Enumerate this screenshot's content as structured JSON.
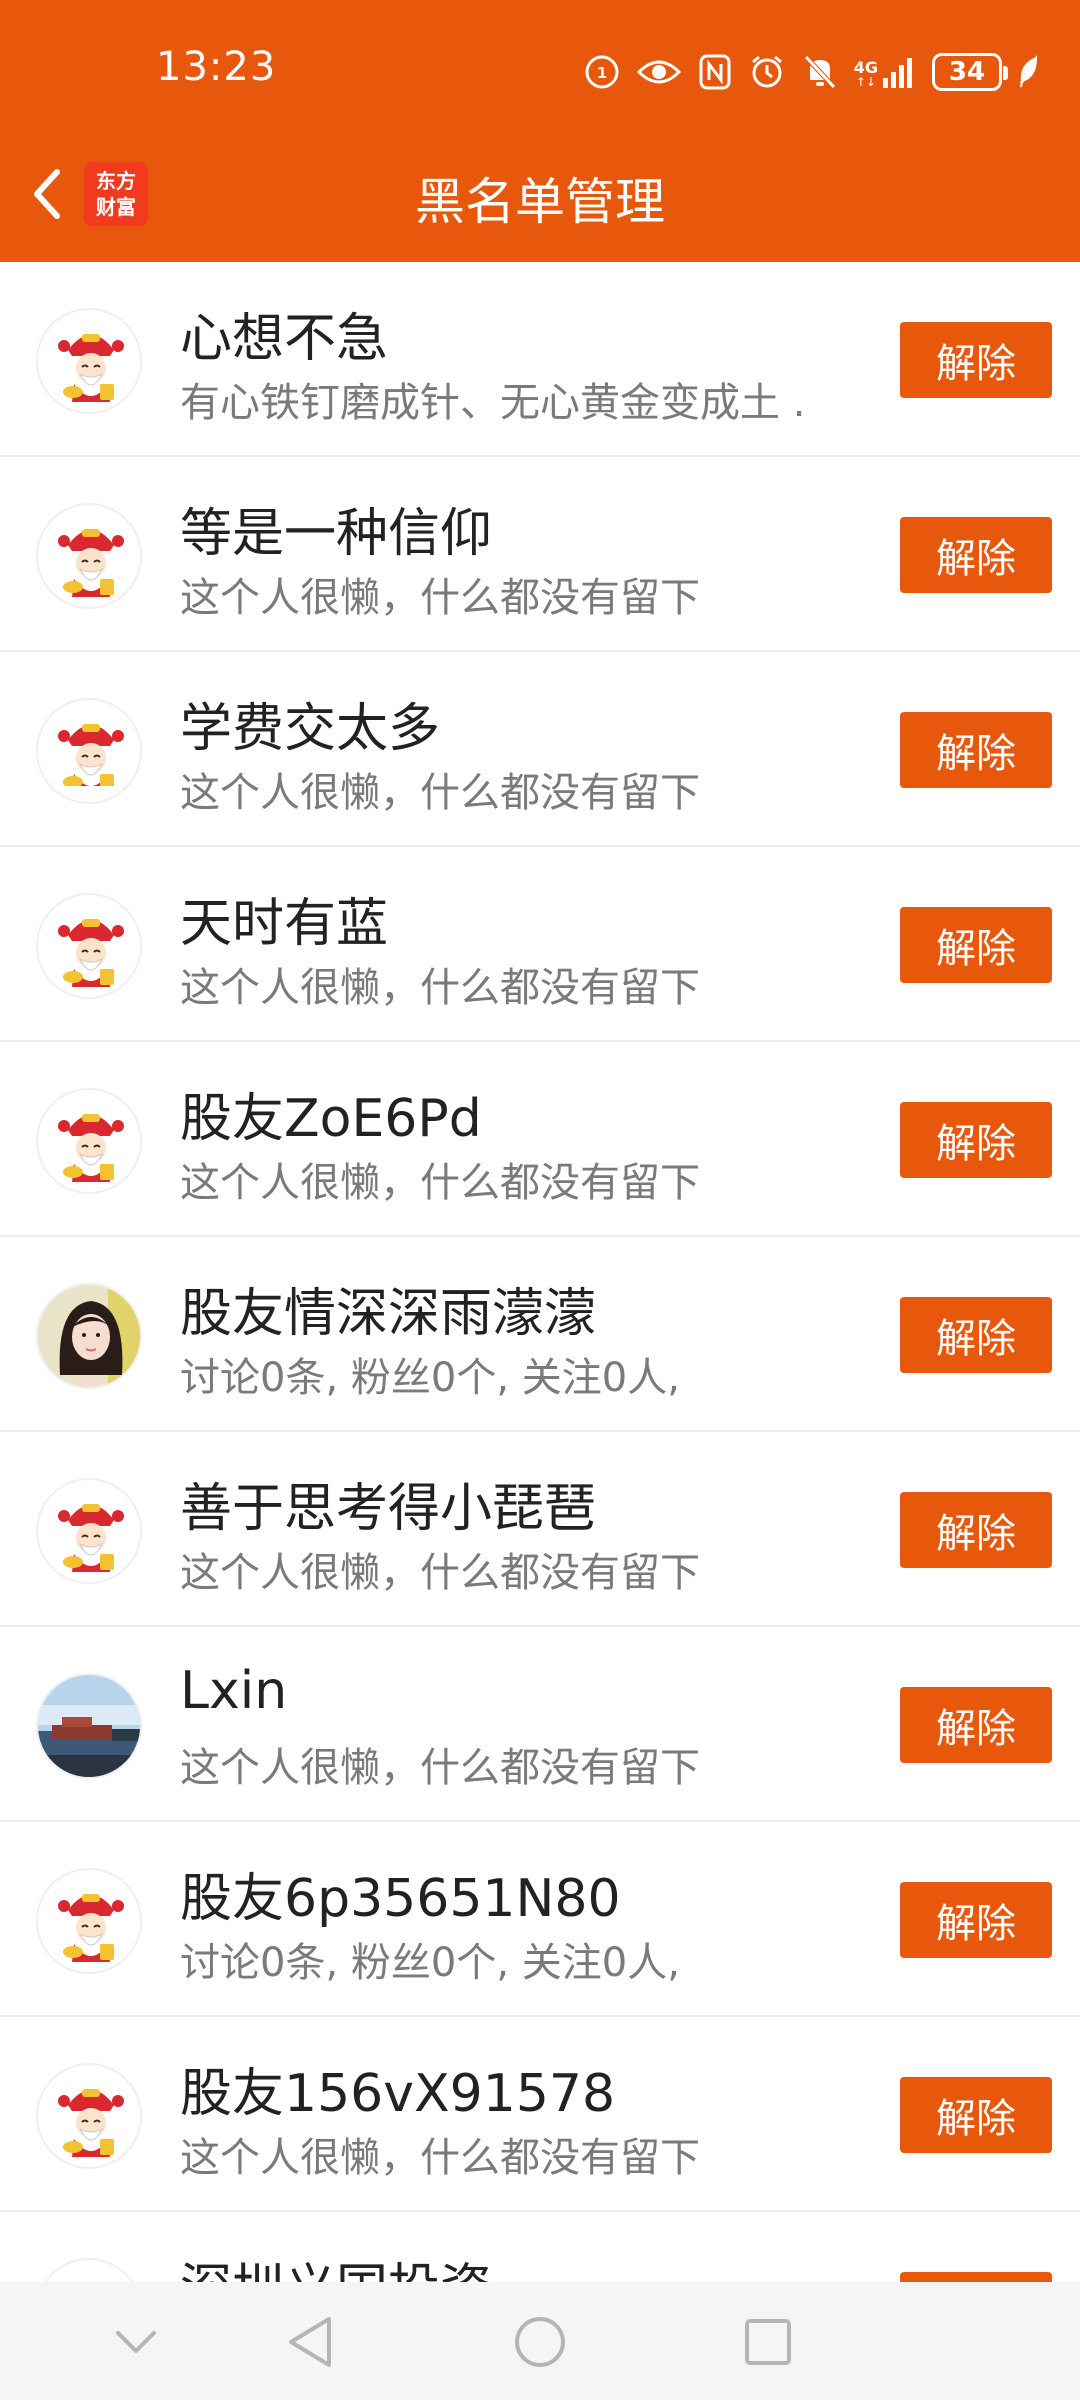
{
  "status_bar": {
    "time": "13:23",
    "network": "4G",
    "battery": "34",
    "icons": [
      "hd-icon",
      "eye-icon",
      "nfc-icon",
      "alarm-icon",
      "mute-icon",
      "signal-icon",
      "battery-icon",
      "leaf-icon"
    ]
  },
  "header": {
    "title": "黑名单管理",
    "logo_line1": "东方",
    "logo_line2": "财富",
    "back_icon": "chevron-left-icon"
  },
  "remove_label": "解除",
  "items": [
    {
      "name": "心想不急",
      "desc": "有心铁钉磨成针、无心黄金变成土 .",
      "avatar": "caishen"
    },
    {
      "name": "等是一种信仰",
      "desc": "这个人很懒，什么都没有留下",
      "avatar": "caishen"
    },
    {
      "name": "学费交太多",
      "desc": "这个人很懒，什么都没有留下",
      "avatar": "caishen-review"
    },
    {
      "name": "天时有蓝",
      "desc": "这个人很懒，什么都没有留下",
      "avatar": "caishen"
    },
    {
      "name": "股友ZoE6Pd",
      "desc": "这个人很懒，什么都没有留下",
      "avatar": "caishen"
    },
    {
      "name": "股友情深深雨濛濛",
      "desc": "讨论0条, 粉丝0个, 关注0人,",
      "avatar": "photo-woman"
    },
    {
      "name": "善于思考得小琵琶",
      "desc": "这个人很懒，什么都没有留下",
      "avatar": "caishen"
    },
    {
      "name": "Lxin",
      "desc": "这个人很懒，什么都没有留下",
      "avatar": "photo-harbor"
    },
    {
      "name": "股友6p35651N80",
      "desc": "讨论0条, 粉丝0个, 关注0人,",
      "avatar": "caishen"
    },
    {
      "name": "股友156vX91578",
      "desc": "这个人很懒，什么都没有留下",
      "avatar": "caishen"
    },
    {
      "name": "深圳义国投资",
      "desc": "",
      "avatar": "caishen"
    }
  ],
  "colors": {
    "accent": "#E8580C",
    "name_text": "#222222",
    "desc_text": "#7A7A7A"
  },
  "nav_bar": {
    "icons": [
      "chevron-down-icon",
      "back-triangle-icon",
      "home-circle-icon",
      "recents-square-icon"
    ]
  }
}
